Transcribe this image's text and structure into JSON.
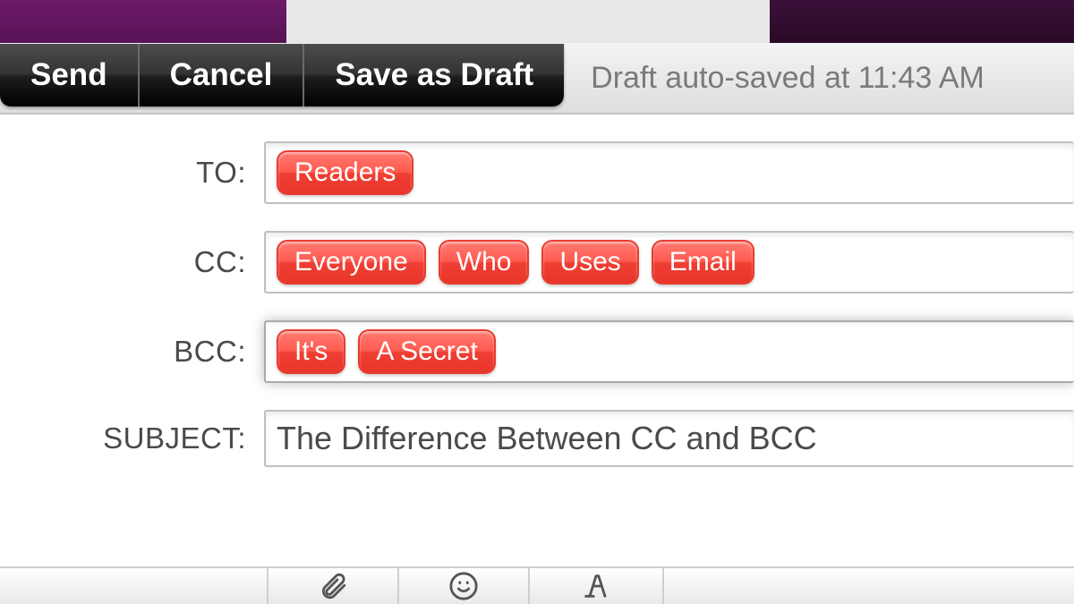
{
  "toolbar": {
    "send_label": "Send",
    "cancel_label": "Cancel",
    "save_draft_label": "Save as Draft",
    "autosave_text": "Draft auto-saved at 11:43 AM"
  },
  "compose": {
    "to_label": "TO:",
    "cc_label": "CC:",
    "bcc_label": "BCC:",
    "subject_label": "SUBJECT:",
    "to_chips": [
      "Readers"
    ],
    "cc_chips": [
      "Everyone",
      "Who",
      "Uses",
      "Email"
    ],
    "bcc_chips": [
      "It's",
      "A Secret"
    ],
    "subject_value": "The Difference Between CC and BCC"
  },
  "colors": {
    "chip_bg": "#ef3e33",
    "button_bg": "#1e1e1e",
    "purple_left": "#571354",
    "purple_right": "#2a0a28"
  }
}
